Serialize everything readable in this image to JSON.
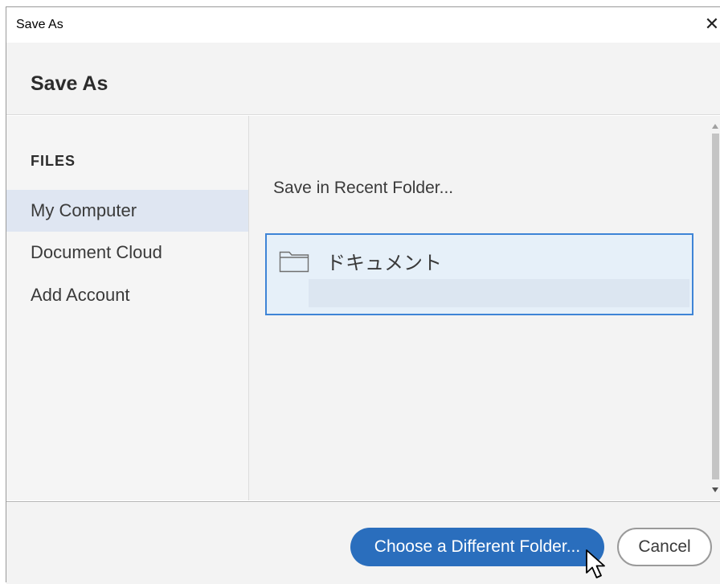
{
  "window": {
    "title": "Save As",
    "close_label": "✕"
  },
  "header": {
    "heading": "Save As"
  },
  "sidebar": {
    "section_label": "FILES",
    "items": [
      {
        "label": "My Computer",
        "selected": true
      },
      {
        "label": "Document Cloud",
        "selected": false
      },
      {
        "label": "Add Account",
        "selected": false
      }
    ]
  },
  "main": {
    "section_title": "Save in Recent Folder...",
    "recent_folders": [
      {
        "name": "ドキュメント",
        "icon": "folder-icon",
        "path": ""
      }
    ]
  },
  "footer": {
    "choose_folder_label": "Choose a Different Folder...",
    "cancel_label": "Cancel"
  },
  "colors": {
    "accent": "#2a6ebd",
    "selection_border": "#3e84d6",
    "selection_fill": "#e6f0f9",
    "sidebar_selected": "#dfe6f2"
  }
}
